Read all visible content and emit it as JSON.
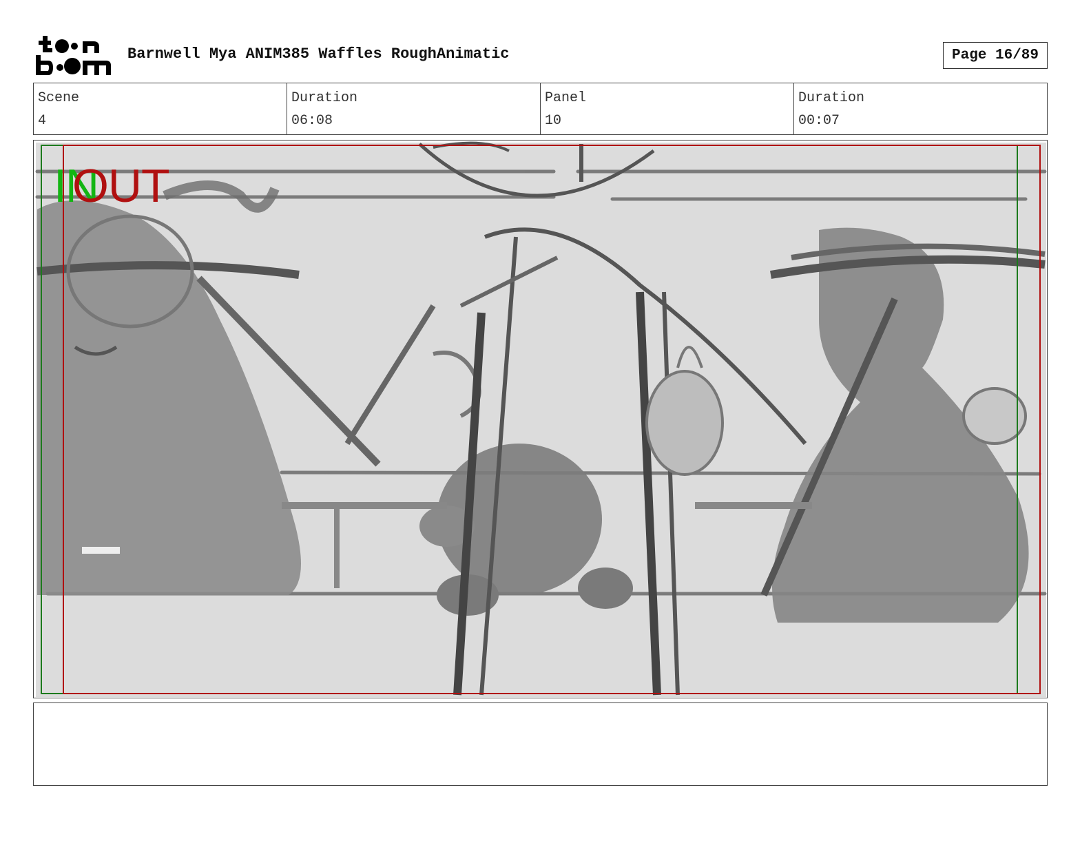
{
  "header": {
    "logo_text": "toon boom",
    "title": "Barnwell Mya ANIM385 Waffles RoughAnimatic",
    "page": "Page 16/89"
  },
  "info": [
    {
      "label": "Scene",
      "value": "4"
    },
    {
      "label": "Duration",
      "value": "06:08"
    },
    {
      "label": "Panel",
      "value": "10"
    },
    {
      "label": "Duration",
      "value": "00:07"
    }
  ],
  "frame": {
    "in_label": "IN",
    "out_label": "OUT",
    "colors": {
      "in": "#13b513",
      "out": "#b01010",
      "sketch_bg": "#dcdcdc"
    }
  },
  "notes": {
    "text": ""
  }
}
